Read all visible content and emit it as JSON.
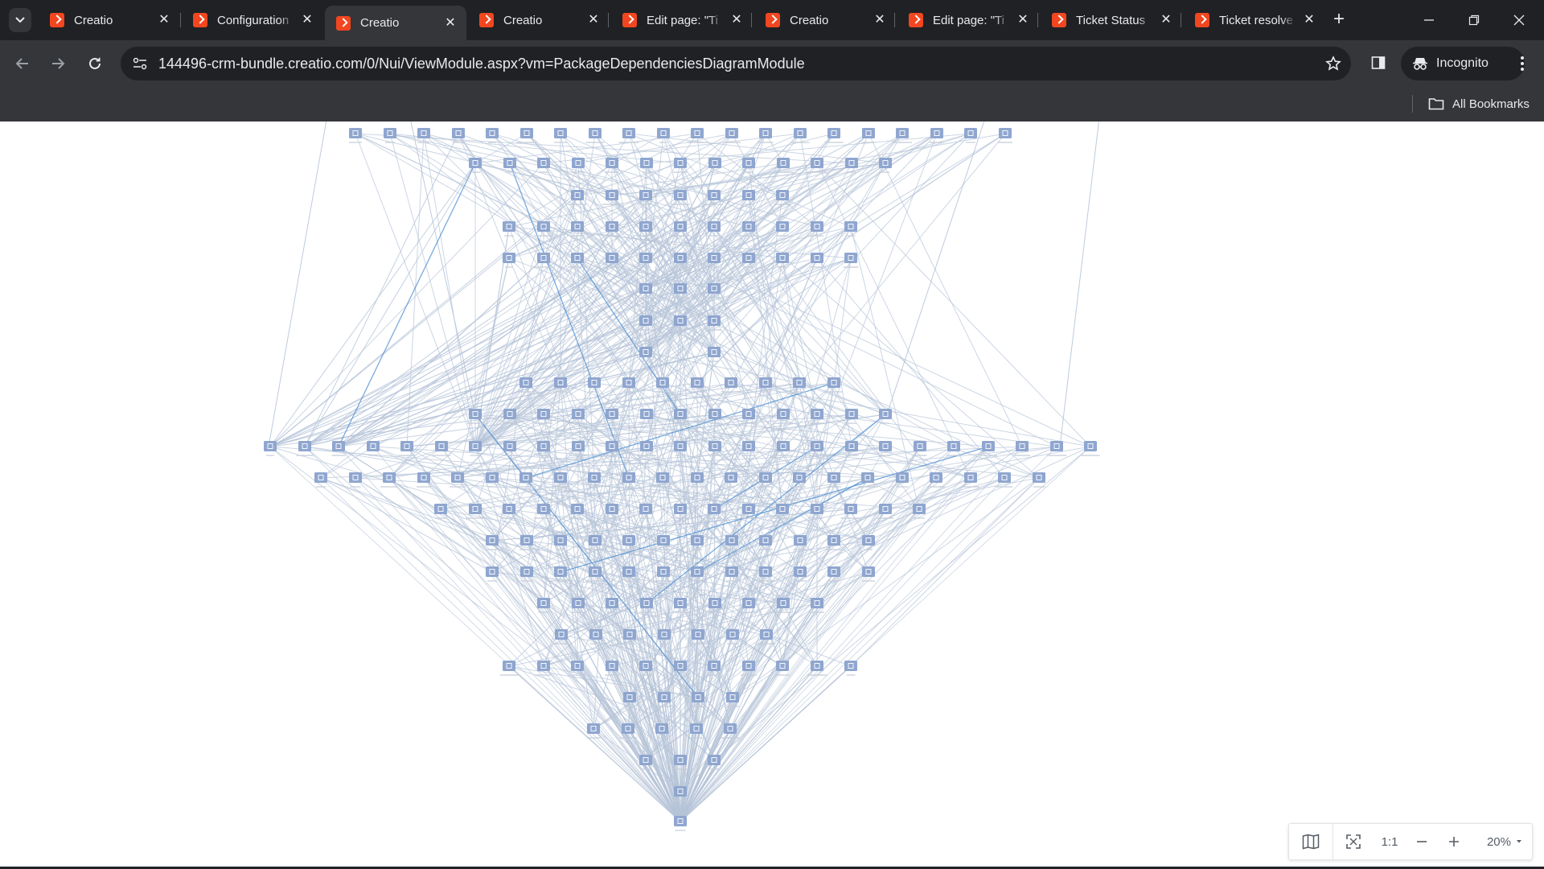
{
  "browser": {
    "tabs": [
      {
        "title": "Creatio",
        "active": false
      },
      {
        "title": "Configuration",
        "active": false
      },
      {
        "title": "Creatio",
        "active": true
      },
      {
        "title": "Creatio",
        "active": false
      },
      {
        "title": "Edit page: \"Ti",
        "active": false
      },
      {
        "title": "Creatio",
        "active": false
      },
      {
        "title": "Edit page: \"Ti",
        "active": false
      },
      {
        "title": "Ticket Status",
        "active": false
      },
      {
        "title": "Ticket resolve",
        "active": false
      }
    ],
    "new_tab_label": "+",
    "url": "144496-crm-bundle.creatio.com/0/Nui/ViewModule.aspx?vm=PackageDependenciesDiagramModule",
    "profile_label": "Incognito",
    "bookmarks_folder_label": "All Bookmarks"
  },
  "diagram": {
    "node_color": "#8fa6cf",
    "edge_color": "#b7c4d9",
    "highlight_edge_color": "#4d8fd1"
  },
  "zoom_toolbar": {
    "actual_size_label": "1:1",
    "zoom_value": "20%"
  },
  "colors": {
    "titlebar": "#202124",
    "toolbar": "#35363a",
    "brand": "#f1461f"
  }
}
